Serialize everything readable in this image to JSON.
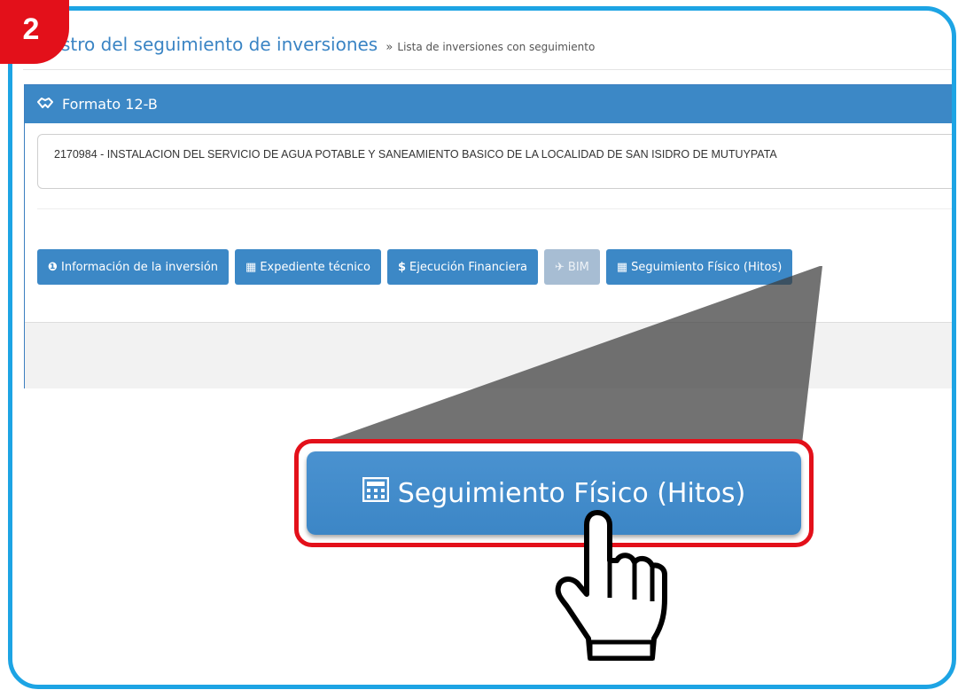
{
  "step_badge": "2",
  "breadcrumb": {
    "main": "stro del seguimiento de inversiones",
    "separator": "»",
    "current": "Lista de inversiones con seguimiento"
  },
  "panel": {
    "icon": "handshake-icon",
    "title": "Formato 12-B",
    "project_text": "2170984 - INSTALACION DEL SERVICIO DE AGUA POTABLE Y SANEAMIENTO BASICO DE LA LOCALIDAD DE SAN ISIDRO DE MUTUYPATA"
  },
  "buttons": [
    {
      "icon": "info-icon",
      "glyph": "❶",
      "label": "Información de la inversión"
    },
    {
      "icon": "calendar-icon",
      "glyph": "▦",
      "label": "Expediente técnico"
    },
    {
      "icon": "dollar-icon",
      "glyph": "$",
      "label": "Ejecución Financiera"
    },
    {
      "icon": "send-icon",
      "glyph": "✈",
      "label": "BIM",
      "disabled": true
    },
    {
      "icon": "calculator-icon",
      "glyph": "▦",
      "label": "Seguimiento Físico (Hitos)"
    }
  ],
  "callout": {
    "icon": "calculator-icon",
    "label": "Seguimiento Físico (Hitos)"
  },
  "colors": {
    "frame": "#1da4e4",
    "accent": "#3c88c6",
    "highlight": "#e3101a",
    "disabled": "#a7bdd3"
  }
}
